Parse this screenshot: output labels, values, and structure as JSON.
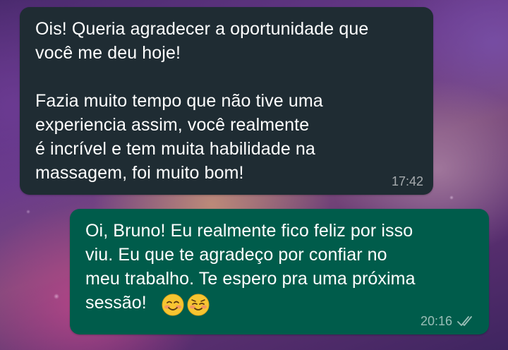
{
  "conversation": {
    "incoming": {
      "text": "Ois! Queria agradecer a oportunidade que\nvocê me deu hoje!\n\nFazia muito tempo que não tive uma\nexperiencia assim, você realmente\né incrível e tem muita habilidade na\nmassagem, foi muito bom!",
      "time": "17:42",
      "bubble_color": "#1f2c33"
    },
    "outgoing": {
      "text": "Oi, Bruno! Eu realmente fico feliz por isso\nviu. Eu que te agradeço por confiar no\nmeu trabalho. Te espero pra uma próxima\nsessão!",
      "emojis": [
        "smiling-face-with-blushing-eyes",
        "relieved-smiling-face"
      ],
      "time": "20:16",
      "status_icon": "double-check-icon",
      "bubble_color": "#005c4b"
    }
  }
}
